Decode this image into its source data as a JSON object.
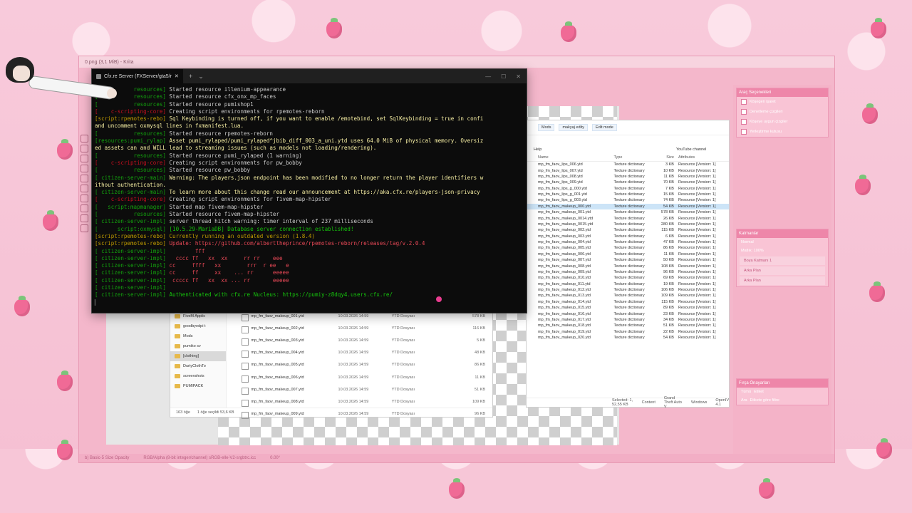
{
  "krita": {
    "title": "0.png (3,1 MiB) - Krita",
    "status_left": "b) Basic-5 Size Opacity",
    "status_mid": "RGB/Alpha (8-bit integer/channel)  sRGB-elle-V2-srgbtrc.icc",
    "status_right": "0.00°",
    "dock": {
      "tabs": [
        "Gelismis Renk Secicisi",
        "Araç Seçenekleri"
      ],
      "options_head": "Araç Seçenekleri",
      "options": [
        "Köşegen işaret",
        "Denetleme çizgileri",
        "Köşeye uygun çizgiler",
        "Yerleştirme kutusu"
      ],
      "layers_head": "Katmanlar",
      "blend": "Normal",
      "opacity": "Matlık: 100%",
      "layers": [
        "Boya Katmanı 1",
        "Arka Plan",
        "Arka Plan"
      ],
      "brush_head": "Fırça Önayarları",
      "brush_tag": "Tümü",
      "brush_tag2": "Etiket",
      "brush_search": "Ara",
      "brush_filter": "Etikete göre filtre"
    }
  },
  "terminal": {
    "tab_title": "Cfx.re Server (FXServer/gta5/r",
    "new_tab": "+",
    "dropdown": "⌄",
    "lines": [
      {
        "tag": "[           resources]",
        "tc": "tag",
        "text": " Started resource illenium-appearance",
        "xc": ""
      },
      {
        "tag": "[           resources]",
        "tc": "tag",
        "text": " Started resource cfx_onx_mp_faces",
        "xc": ""
      },
      {
        "tag": "[           resources]",
        "tc": "tag",
        "text": " Started resource pumishop1",
        "xc": ""
      },
      {
        "tag": "[    c-scripting-core]",
        "tc": "tag-red",
        "text": " Creating script environments for rpemotes-reborn",
        "xc": ""
      },
      {
        "tag": "[script:rpemotes-rebo]",
        "tc": "tag-orange",
        "text": " Sql Keybinding is turned off, if you want to enable /emotebind, set SqlKeybinding = true in confi",
        "xc": "txt-yellow"
      },
      {
        "tag": "",
        "tc": "tag",
        "text": "and uncomment oxmysql lines in fxmanifest.lua.",
        "xc": "txt-yellow"
      },
      {
        "tag": "[           resources]",
        "tc": "tag",
        "text": " Started resource rpemotes-reborn",
        "xc": ""
      },
      {
        "tag": "[resources:pumi_rylap]",
        "tc": "tag",
        "text": " Asset pumi_rylaped/pumi_rylaped^jbib_diff_003_a_uni.ytd uses 64.0 MiB of physical memory. Oversiz",
        "xc": "txt-yellow"
      },
      {
        "tag": "",
        "tc": "tag",
        "text": "ed assets can and WILL lead to streaming issues (such as models not loading/rendering).",
        "xc": "txt-yellow"
      },
      {
        "tag": "[           resources]",
        "tc": "tag",
        "text": " Started resource pumi_rylaped (1 warning)",
        "xc": ""
      },
      {
        "tag": "[    c-scripting-core]",
        "tc": "tag-red",
        "text": " Creating script environments for pw_bobby",
        "xc": ""
      },
      {
        "tag": "[           resources]",
        "tc": "tag",
        "text": " Started resource pw_bobby",
        "xc": ""
      },
      {
        "tag": "[ citizen-server-main]",
        "tc": "tag",
        "text": " Warning: The players.json endpoint has been modified to no longer return the player identifiers w",
        "xc": "txt-yellow"
      },
      {
        "tag": "",
        "tc": "tag",
        "text": "ithout authentication.",
        "xc": "txt-yellow"
      },
      {
        "tag": "[ citizen-server-main]",
        "tc": "tag",
        "text": " To learn more about this change read our announcement at https://aka.cfx.re/players-json-privacy",
        "xc": "txt-yellow"
      },
      {
        "tag": "[    c-scripting-core]",
        "tc": "tag-red",
        "text": " Creating script environments for fivem-map-hipster",
        "xc": ""
      },
      {
        "tag": "[   script:mapmanager]",
        "tc": "tag",
        "text": " Started map fivem-map-hipster",
        "xc": ""
      },
      {
        "tag": "[           resources]",
        "tc": "tag",
        "text": " Started resource fivem-map-hipster",
        "xc": ""
      },
      {
        "tag": "[ citizen-server-impl]",
        "tc": "tag",
        "text": " server thread hitch warning: timer interval of 237 milliseconds",
        "xc": ""
      },
      {
        "tag": "[      script:oxmysql]",
        "tc": "tag",
        "text": " [10.5.29-MariaDB] Database server connection established!",
        "xc": "txt-green"
      },
      {
        "tag": "[script:rpemotes-rebo]",
        "tc": "tag-orange",
        "text": " Currently running an outdated version (1.8.4)",
        "xc": "txt-orange"
      },
      {
        "tag": "[script:rpemotes-rebo]",
        "tc": "tag-orange",
        "text": " Update: https://github.com/alberttheprince/rpemotes-reborn/releases/tag/v.2.0.4",
        "xc": "txt-red"
      },
      {
        "tag": "[ citizen-server-impl]",
        "tc": "tag",
        "text": "         fff",
        "xc": "txt-red"
      },
      {
        "tag": "[ citizen-server-impl]",
        "tc": "tag",
        "text": "   cccc ff   xx  xx     rr rr    eee",
        "xc": "txt-red"
      },
      {
        "tag": "[ citizen-server-impl]",
        "tc": "tag",
        "text": " cc     ffff   xx        rrr  r ee   e",
        "xc": "txt-red"
      },
      {
        "tag": "[ citizen-server-impl]",
        "tc": "tag",
        "text": " cc     ff     xx    ... rr      eeeee",
        "xc": "txt-red"
      },
      {
        "tag": "[ citizen-server-impl]",
        "tc": "tag",
        "text": "  ccccc ff   xx  xx ... rr       eeeee",
        "xc": "txt-red"
      },
      {
        "tag": "[ citizen-server-impl]",
        "tc": "tag",
        "text": "",
        "xc": ""
      },
      {
        "tag": "[ citizen-server-impl]",
        "tc": "tag",
        "text": " Authenticated with cfx.re Nucleus: https://pumiy-z8dqy4.users.cfx.re/",
        "xc": "txt-green"
      }
    ]
  },
  "explorer_right": {
    "breadcrumb": [
      "Mods",
      "makyaj edity"
    ],
    "edit_mode": "Edit mode",
    "menu_help": "Help",
    "youtube": "YouTube channel",
    "columns": [
      "Name",
      "Type",
      "Size",
      "Attributes"
    ],
    "rows": [
      {
        "name": "mp_fm_faov_lips_006.ytd",
        "type": "Texture dictionary",
        "size": "3 KB",
        "attr": "Resource [Version: 1]"
      },
      {
        "name": "mp_fm_faov_lips_007.ytd",
        "type": "Texture dictionary",
        "size": "10 KB",
        "attr": "Resource [Version: 1]"
      },
      {
        "name": "mp_fm_faov_lips_008.ytd",
        "type": "Texture dictionary",
        "size": "11 KB",
        "attr": "Resource [Version: 1]"
      },
      {
        "name": "mp_fm_faov_lips_009.ytd",
        "type": "Texture dictionary",
        "size": "70 KB",
        "attr": "Resource [Version: 1]"
      },
      {
        "name": "mp_fm_faov_lips_g_000.ytd",
        "type": "Texture dictionary",
        "size": "7 KB",
        "attr": "Resource [Version: 1]"
      },
      {
        "name": "mp_fm_faov_lips_g_001.ytd",
        "type": "Texture dictionary",
        "size": "15 KB",
        "attr": "Resource [Version: 1]"
      },
      {
        "name": "mp_fm_faov_lips_g_003.ytd",
        "type": "Texture dictionary",
        "size": "74 KB",
        "attr": "Resource [Version: 1]"
      },
      {
        "name": "mp_fm_faov_makeup_000.ytd",
        "type": "Texture dictionary",
        "size": "54 KB",
        "attr": "Resource [Version: 1]"
      },
      {
        "name": "mp_fm_faov_makeup_001.ytd",
        "type": "Texture dictionary",
        "size": "578 KB",
        "attr": "Resource [Version: 1]"
      },
      {
        "name": "mp_fm_faov_makeup_0014.ytd",
        "type": "Texture dictionary",
        "size": "26 KB",
        "attr": "Resource [Version: 1]"
      },
      {
        "name": "mp_fm_faov_makeup_0015.ytd",
        "type": "Texture dictionary",
        "size": "280 KB",
        "attr": "Resource [Version: 1]"
      },
      {
        "name": "mp_fm_faov_makeup_002.ytd",
        "type": "Texture dictionary",
        "size": "115 KB",
        "attr": "Resource [Version: 1]"
      },
      {
        "name": "mp_fm_faov_makeup_003.ytd",
        "type": "Texture dictionary",
        "size": "6 KB",
        "attr": "Resource [Version: 1]"
      },
      {
        "name": "mp_fm_faov_makeup_004.ytd",
        "type": "Texture dictionary",
        "size": "47 KB",
        "attr": "Resource [Version: 1]"
      },
      {
        "name": "mp_fm_faov_makeup_005.ytd",
        "type": "Texture dictionary",
        "size": "86 KB",
        "attr": "Resource [Version: 1]"
      },
      {
        "name": "mp_fm_faov_makeup_006.ytd",
        "type": "Texture dictionary",
        "size": "11 KB",
        "attr": "Resource [Version: 1]"
      },
      {
        "name": "mp_fm_faov_makeup_007.ytd",
        "type": "Texture dictionary",
        "size": "50 KB",
        "attr": "Resource [Version: 1]"
      },
      {
        "name": "mp_fm_faov_makeup_008.ytd",
        "type": "Texture dictionary",
        "size": "108 KB",
        "attr": "Resource [Version: 1]"
      },
      {
        "name": "mp_fm_faov_makeup_009.ytd",
        "type": "Texture dictionary",
        "size": "96 KB",
        "attr": "Resource [Version: 1]"
      },
      {
        "name": "mp_fm_faov_makeup_010.ytd",
        "type": "Texture dictionary",
        "size": "69 KB",
        "attr": "Resource [Version: 1]"
      },
      {
        "name": "mp_fm_faov_makeup_011.ytd",
        "type": "Texture dictionary",
        "size": "19 KB",
        "attr": "Resource [Version: 1]"
      },
      {
        "name": "mp_fm_faov_makeup_012.ytd",
        "type": "Texture dictionary",
        "size": "106 KB",
        "attr": "Resource [Version: 1]"
      },
      {
        "name": "mp_fm_faov_makeup_013.ytd",
        "type": "Texture dictionary",
        "size": "109 KB",
        "attr": "Resource [Version: 1]"
      },
      {
        "name": "mp_fm_faov_makeup_014.ytd",
        "type": "Texture dictionary",
        "size": "115 KB",
        "attr": "Resource [Version: 1]"
      },
      {
        "name": "mp_fm_faov_makeup_015.ytd",
        "type": "Texture dictionary",
        "size": "89 KB",
        "attr": "Resource [Version: 1]"
      },
      {
        "name": "mp_fm_faov_makeup_016.ytd",
        "type": "Texture dictionary",
        "size": "23 KB",
        "attr": "Resource [Version: 1]"
      },
      {
        "name": "mp_fm_faov_makeup_017.ytd",
        "type": "Texture dictionary",
        "size": "34 KB",
        "attr": "Resource [Version: 1]"
      },
      {
        "name": "mp_fm_faov_makeup_018.ytd",
        "type": "Texture dictionary",
        "size": "51 KB",
        "attr": "Resource [Version: 1]"
      },
      {
        "name": "mp_fm_faov_makeup_019.ytd",
        "type": "Texture dictionary",
        "size": "22 KB",
        "attr": "Resource [Version: 1]"
      },
      {
        "name": "mp_fm_faov_makeup_020.ytd",
        "type": "Texture dictionary",
        "size": "54 KB",
        "attr": "Resource [Version: 1]"
      }
    ],
    "status": [
      "Selected: 1, 52,55 KB",
      "Content",
      "Grand Theft Auto V",
      "Windows",
      "OpenIV 4.1"
    ]
  },
  "explorer_left": {
    "sidebar": [
      "FiveM Applic",
      "goodbyedpi t",
      "Mods",
      "pumiko sv",
      "[clothing]",
      "DurtyClothTo",
      "screenshots",
      "PUMIPACK"
    ],
    "sidebar_selected": 4,
    "rows": [
      {
        "name": "mp_fm_faov_makeup_001.ytd",
        "date": "10.03.2026 14:59",
        "type": "YTD Dosyası",
        "size": "578 KB"
      },
      {
        "name": "mp_fm_faov_makeup_002.ytd",
        "date": "10.03.2026 14:59",
        "type": "YTD Dosyası",
        "size": "116 KB"
      },
      {
        "name": "mp_fm_faov_makeup_003.ytd",
        "date": "10.03.2026 14:59",
        "type": "YTD Dosyası",
        "size": "5 KB"
      },
      {
        "name": "mp_fm_faov_makeup_004.ytd",
        "date": "10.03.2026 14:59",
        "type": "YTD Dosyası",
        "size": "48 KB"
      },
      {
        "name": "mp_fm_faov_makeup_005.ytd",
        "date": "10.03.2026 14:59",
        "type": "YTD Dosyası",
        "size": "86 KB"
      },
      {
        "name": "mp_fm_faov_makeup_006.ytd",
        "date": "10.03.2026 14:59",
        "type": "YTD Dosyası",
        "size": "11 KB"
      },
      {
        "name": "mp_fm_faov_makeup_007.ytd",
        "date": "10.03.2026 14:59",
        "type": "YTD Dosyası",
        "size": "51 KB"
      },
      {
        "name": "mp_fm_faov_makeup_008.ytd",
        "date": "10.03.2026 14:59",
        "type": "YTD Dosyası",
        "size": "109 KB"
      },
      {
        "name": "mp_fm_faov_makeup_009.ytd",
        "date": "10.03.2026 14:59",
        "type": "YTD Dosyası",
        "size": "96 KB"
      }
    ],
    "status_items": "163 öğe",
    "status_selected": "1 öğe seçildi  53,6 KB"
  }
}
